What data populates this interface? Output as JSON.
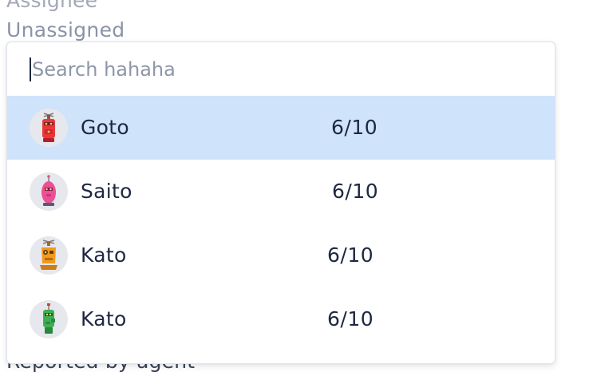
{
  "field": {
    "above_label": "Assignee",
    "value": "Unassigned",
    "below_text": "Reported by agent"
  },
  "dropdown": {
    "search_placeholder": "Search hahaha",
    "options": [
      {
        "name": "Goto",
        "count": "6/10",
        "avatar_icon": "red-robot-icon",
        "avatar_color": "#e8373a",
        "selected": true
      },
      {
        "name": "Saito",
        "count": "6/10",
        "avatar_icon": "pink-robot-icon",
        "avatar_color": "#ec4f96",
        "selected": false
      },
      {
        "name": "Kato",
        "count": "6/10",
        "avatar_icon": "orange-robot-icon",
        "avatar_color": "#f19a1d",
        "selected": false
      },
      {
        "name": "Kato",
        "count": "6/10",
        "avatar_icon": "green-robot-icon",
        "avatar_color": "#3fae57",
        "selected": false
      }
    ]
  },
  "colors": {
    "highlight": "#cfe3fb",
    "text": "#1d2742",
    "muted": "#8b93a6"
  }
}
